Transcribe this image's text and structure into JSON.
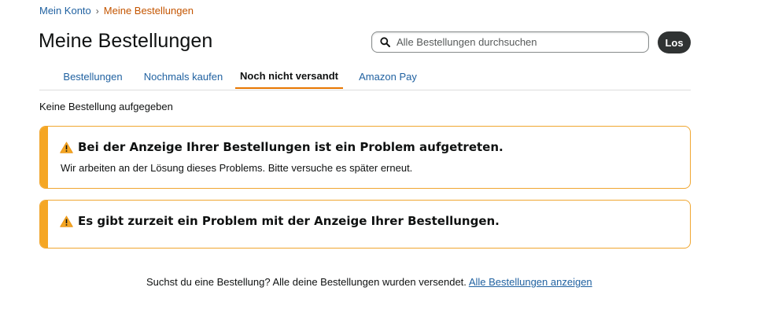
{
  "breadcrumb": {
    "account_label": "Mein Konto",
    "separator": "›",
    "current_label": "Meine Bestellungen"
  },
  "page": {
    "title": "Meine Bestellungen"
  },
  "search": {
    "placeholder": "Alle Bestellungen durchsuchen",
    "value": "",
    "button_label": "Los"
  },
  "tabs": [
    {
      "label": "Bestellungen",
      "active": false
    },
    {
      "label": "Nochmals kaufen",
      "active": false
    },
    {
      "label": "Noch nicht versandt",
      "active": true
    },
    {
      "label": "Amazon Pay",
      "active": false
    }
  ],
  "status_text": "Keine Bestellung aufgegeben",
  "alerts": [
    {
      "icon": "warning-icon",
      "heading": "Bei der Anzeige Ihrer Bestellungen ist ein Problem aufgetreten.",
      "body": "Wir arbeiten an der Lösung dieses Problems. Bitte versuche es später erneut."
    },
    {
      "icon": "warning-icon",
      "heading": "Es gibt zurzeit ein Problem mit der Anzeige Ihrer Bestellungen."
    }
  ],
  "footer": {
    "text": "Suchst du eine Bestellung? Alle deine Bestellungen wurden versendet.",
    "link_label": "Alle Bestellungen anzeigen"
  },
  "colors": {
    "link": "#2162a1",
    "breadcrumb_current": "#c45500",
    "tab_active_underline": "#e77600",
    "alert_border": "#f0a630",
    "alert_accent": "#f5a623",
    "button_bg": "#303333"
  }
}
